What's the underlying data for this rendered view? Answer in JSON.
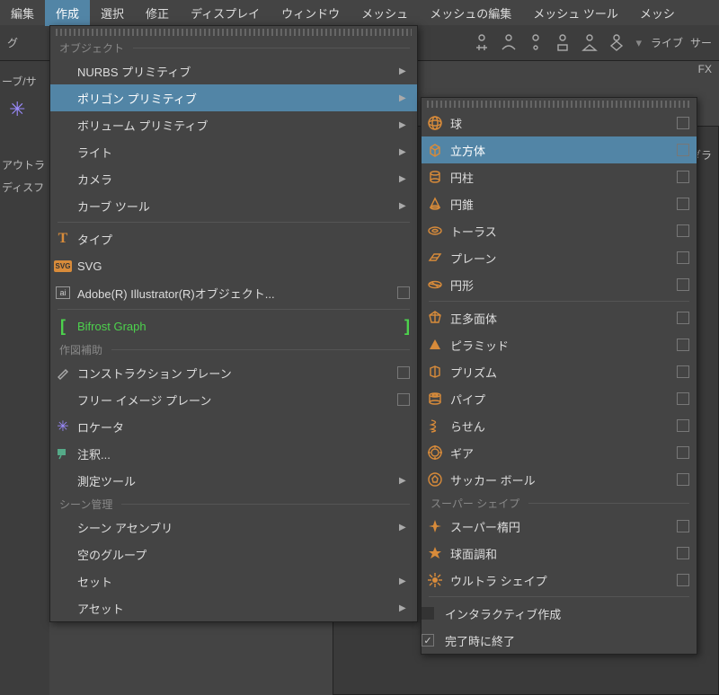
{
  "menubar": [
    "編集",
    "作成",
    "選択",
    "修正",
    "ディスプレイ",
    "ウィンドウ",
    "メッシュ",
    "メッシュの編集",
    "メッシュ ツール",
    "メッシ"
  ],
  "menubar_active_index": 1,
  "left_fragments": {
    "g": "グ",
    "curve": "ーブ/サ",
    "out": "アウトラ",
    "disp": "ディスフ"
  },
  "right_fragments": {
    "live": "ライブ",
    "sa": "サー",
    "fx": "FX",
    "dara": "ダラ"
  },
  "main_menu": {
    "sections": {
      "objects": "オブジェクト",
      "drawing": "作図補助",
      "scene": "シーン管理"
    },
    "items": [
      {
        "label": "NURBS プリミティブ",
        "arrow": true
      },
      {
        "label": "ポリゴン プリミティブ",
        "arrow": true,
        "hover": true
      },
      {
        "label": "ボリューム プリミティブ",
        "arrow": true
      },
      {
        "label": "ライト",
        "arrow": true
      },
      {
        "label": "カメラ",
        "arrow": true
      },
      {
        "label": "カーブ ツール",
        "arrow": true
      }
    ],
    "items2": [
      {
        "label": "タイプ",
        "icon": "type"
      },
      {
        "label": "SVG",
        "icon": "svg"
      },
      {
        "label": "Adobe(R) Illustrator(R)オブジェクト...",
        "icon": "ai",
        "box": true
      }
    ],
    "bifrost": "Bifrost Graph",
    "drawing_items": [
      {
        "label": "コンストラクション プレーン",
        "icon": "cplane",
        "box": true
      },
      {
        "label": "フリー イメージ プレーン",
        "box": true
      },
      {
        "label": "ロケータ",
        "icon": "locator"
      },
      {
        "label": "注釈...",
        "icon": "annot"
      },
      {
        "label": "測定ツール",
        "arrow": true
      }
    ],
    "scene_items": [
      {
        "label": "シーン アセンブリ",
        "arrow": true
      },
      {
        "label": "空のグループ"
      },
      {
        "label": "セット",
        "arrow": true
      },
      {
        "label": "アセット",
        "arrow": true
      }
    ]
  },
  "submenu": {
    "items": [
      {
        "label": "球",
        "icon": "sphere"
      },
      {
        "label": "立方体",
        "icon": "cube",
        "hover": true
      },
      {
        "label": "円柱",
        "icon": "cylinder"
      },
      {
        "label": "円錐",
        "icon": "cone"
      },
      {
        "label": "トーラス",
        "icon": "torus"
      },
      {
        "label": "プレーン",
        "icon": "plane"
      },
      {
        "label": "円形",
        "icon": "disc"
      }
    ],
    "items2": [
      {
        "label": "正多面体",
        "icon": "platonic"
      },
      {
        "label": "ピラミッド",
        "icon": "pyramid"
      },
      {
        "label": "プリズム",
        "icon": "prism"
      },
      {
        "label": "パイプ",
        "icon": "pipe"
      },
      {
        "label": "らせん",
        "icon": "helix"
      },
      {
        "label": "ギア",
        "icon": "gear"
      },
      {
        "label": "サッカー ボール",
        "icon": "soccer"
      }
    ],
    "section_super": "スーパー シェイプ",
    "items3": [
      {
        "label": "スーパー楕円",
        "icon": "sellipse"
      },
      {
        "label": "球面調和",
        "icon": "sharm"
      },
      {
        "label": "ウルトラ シェイプ",
        "icon": "ultra"
      }
    ],
    "footer": [
      {
        "label": "インタラクティブ作成",
        "check": false
      },
      {
        "label": "完了時に終了",
        "check": true
      }
    ]
  }
}
